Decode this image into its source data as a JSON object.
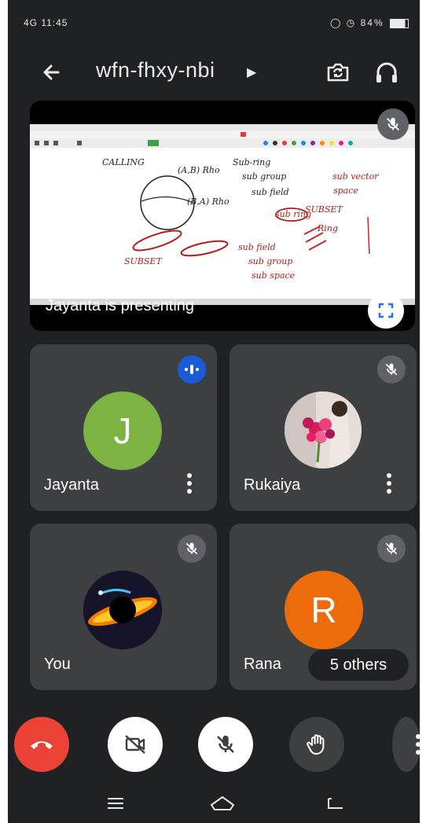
{
  "status_bar": {
    "left": "4G 11:45",
    "right": "84%"
  },
  "header": {
    "meeting_code": "wfn-fhxy-nbi"
  },
  "presentation": {
    "label": "Jayanta is presenting",
    "slide_text": [
      "CALLING",
      "(A,B) Rho",
      "(B,A) Rho",
      "Sub-ring",
      "sub group",
      "sub field",
      "sub ring",
      "SUBSET",
      "sub field",
      "sub group",
      "sub space",
      "sub vector",
      "space",
      "SUBSET",
      "Ring"
    ]
  },
  "participants": [
    {
      "name": "Jayanta",
      "initial": "J",
      "avatar_color": "#7cb342",
      "speaking": true
    },
    {
      "name": "Rukaiya",
      "initial": "",
      "avatar_color": "#d8c6c4",
      "speaking": false
    },
    {
      "name": "You",
      "initial": "",
      "avatar_color": "#1b1a2e",
      "speaking": false
    },
    {
      "name": "Rana",
      "initial": "R",
      "avatar_color": "#ec6c0c",
      "speaking": false
    }
  ],
  "others": {
    "label": "5 others"
  },
  "colors": {
    "background": "#202124",
    "tile": "#3c4043",
    "end_call": "#ea4335",
    "speaking": "#1a5cd8"
  }
}
